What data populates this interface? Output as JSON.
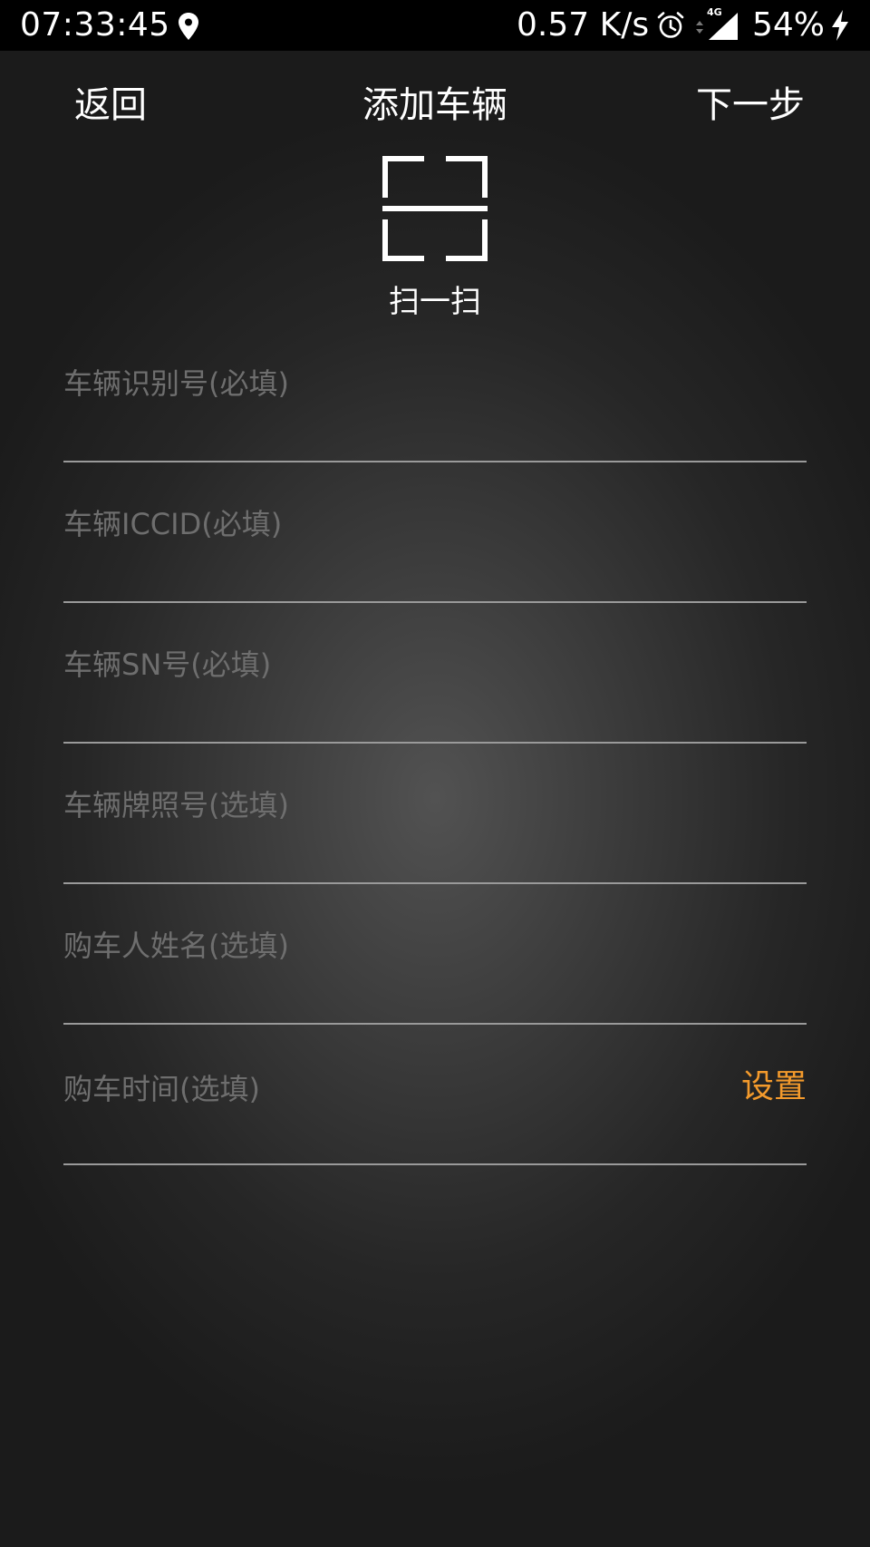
{
  "status_bar": {
    "time": "07:33:45",
    "net_speed": "0.57 K/s",
    "network_type": "4G",
    "battery": "54%",
    "icons": [
      "location-icon",
      "alarm-icon",
      "signal-icon",
      "charging-icon"
    ]
  },
  "nav": {
    "back_label": "返回",
    "title": "添加车辆",
    "next_label": "下一步"
  },
  "scan": {
    "icon": "scan-frame-icon",
    "label": "扫一扫"
  },
  "form": {
    "vin_placeholder": "车辆识别号(必填)",
    "iccid_placeholder": "车辆ICCID(必填)",
    "sn_placeholder": "车辆SN号(必填)",
    "plate_placeholder": "车辆牌照号(选填)",
    "buyer_placeholder": "购车人姓名(选填)",
    "purchase_time_label": "购车时间(选填)",
    "purchase_time_action": "设置"
  },
  "colors": {
    "accent": "#f39a2c",
    "placeholder": "#6e6e6e",
    "divider": "#9a9a9a",
    "status_bar_bg": "#000000"
  }
}
